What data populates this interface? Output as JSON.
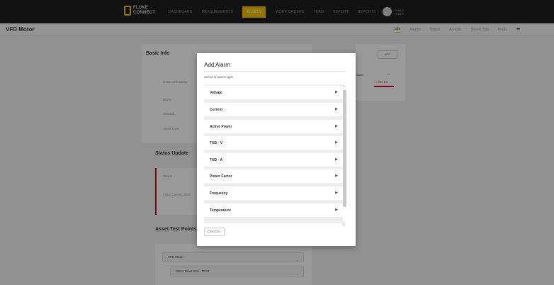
{
  "topnav": {
    "logo_line1": "FLUKE",
    "logo_line2": "CONNECT",
    "items": [
      {
        "label": "DASHBOARD",
        "active": false
      },
      {
        "label": "MEASUREMENTS",
        "active": false
      },
      {
        "label": "ASSETS",
        "active": true
      },
      {
        "label": "WORK ORDERS",
        "active": false
      },
      {
        "label": "TEAM",
        "active": false
      },
      {
        "label": "EXPORT",
        "active": false
      },
      {
        "label": "REPORTS",
        "active": false
      }
    ],
    "user_line1": "Fluke E",
    "user_line2": "Fluke E"
  },
  "header": {
    "title": "VFD Motor",
    "tabs": [
      {
        "label": "Info",
        "active": true
      },
      {
        "label": "Alarms",
        "active": false
      },
      {
        "label": "Status",
        "active": false
      },
      {
        "label": "Analytic",
        "active": false
      },
      {
        "label": "Saved data",
        "active": false
      },
      {
        "label": "Photo",
        "active": false
      }
    ]
  },
  "background": {
    "basic_info_title": "Basic Info",
    "asset_name_row": "Union VFD Motor",
    "name_label": "Name",
    "asset_id_label": "Asset Id",
    "asset_type_label": "Asset Type",
    "status_update_title": "Status Update",
    "status_label": "Status",
    "fluke_connect_label": "Fluke Connect Devi",
    "asset_test_points_title": "Asset Test Points",
    "add_label": "ADD",
    "alarm_header": "Alarm",
    "alarm_more": "•••",
    "alarm_value": "> 30V DC",
    "tree_items": [
      "VFD Motor",
      "Motor Drive End - TEST"
    ]
  },
  "modal": {
    "title": "Add Alarm",
    "subtitle": "Select an alarm type",
    "options": [
      "Voltage",
      "Current",
      "Active Power",
      "THD - V",
      "THD - A",
      "Power Factor",
      "Frequency",
      "Temperature"
    ],
    "option_arrow": "▶",
    "cancel_label": "CANCEL"
  },
  "colors": {
    "accent": "#f2c400",
    "nav_bg": "#1e1e1e",
    "alert_red": "#c8102e"
  }
}
